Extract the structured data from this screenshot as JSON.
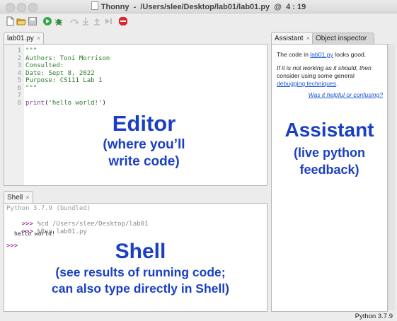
{
  "window": {
    "title": "Thonny  -  /Users/slee/Desktop/lab01/lab01.py  @  4 : 19"
  },
  "toolbar": {
    "icons": [
      "new-file-icon",
      "open-file-icon",
      "save-icon",
      "run-icon",
      "debug-icon",
      "step-over-icon",
      "step-into-icon",
      "step-out-icon",
      "resume-icon",
      "stop-icon"
    ]
  },
  "editor": {
    "tab_label": "lab01.py",
    "close_glyph": "×",
    "lines": [
      {
        "n": "1",
        "text": "\"\"\""
      },
      {
        "n": "2",
        "text": "Authors: Toni Morrison"
      },
      {
        "n": "3",
        "text": "Consulted:"
      },
      {
        "n": "4",
        "text": "Date: Sept 8, 2022"
      },
      {
        "n": "5",
        "text": "Purpose: CS111 Lab 1"
      },
      {
        "n": "6",
        "text": "\"\"\""
      },
      {
        "n": "7",
        "text": ""
      },
      {
        "n": "8",
        "text": ""
      }
    ],
    "print_line": {
      "fn": "print",
      "open": "(",
      "str": "'hello world!'",
      "close": ")"
    },
    "annotation_title": "Editor",
    "annotation_line1": "(where you’ll",
    "annotation_line2": "write code)"
  },
  "shell": {
    "tab_label": "Shell",
    "close_glyph": "×",
    "banner": "Python 3.7.9 (bundled)",
    "prompt": ">>>",
    "cmd1": "%cd /Users/slee/Desktop/lab01",
    "cmd2": "%Run lab01.py",
    "output": "hello world!",
    "annotation_title": "Shell",
    "annotation_line1": "(see results of running code;",
    "annotation_line2": "can also type directly in Shell)"
  },
  "assistant": {
    "tab_label": "Assistant",
    "close_glyph": "×",
    "tab2_label": "Object inspector",
    "msg_prefix": "The code in ",
    "msg_link": "lab01.py",
    "msg_suffix": " looks good.",
    "hint_line1": "If it is not working as it should, then",
    "hint_line2": "consider using some general",
    "hint_link": "debugging techniques",
    "hint_end": ".",
    "feedback_link": "Was it helpful or confusing?",
    "annotation_title": "Assistant",
    "annotation_line1": "(live python",
    "annotation_line2": "feedback)"
  },
  "statusbar": {
    "text": "Python 3.7.9"
  },
  "colors": {
    "accent": "#1a3fc2",
    "string": "#2a7a2a",
    "prompt": "#8b008b",
    "link": "#1a55d8",
    "stop": "#d9262c"
  }
}
